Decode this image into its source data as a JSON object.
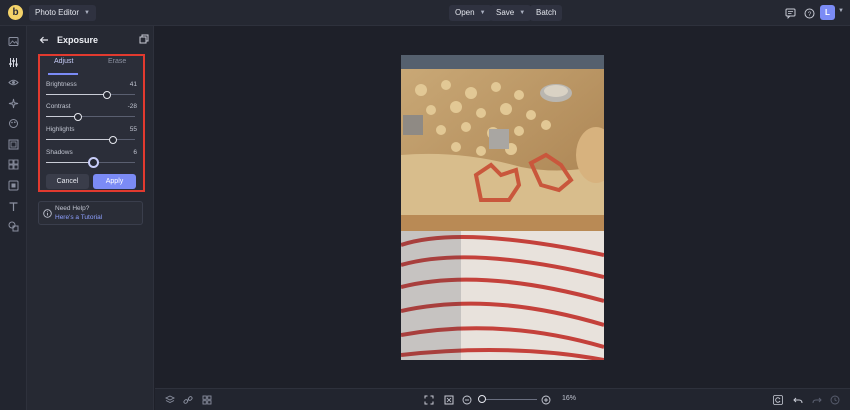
{
  "topbar": {
    "logo_letter": "b",
    "app_switch_label": "Photo Editor",
    "open_label": "Open",
    "save_label": "Save",
    "batch_label": "Batch",
    "avatar_letter": "L"
  },
  "panel": {
    "title": "Exposure",
    "tabs": [
      {
        "label": "Adjust",
        "active": true
      },
      {
        "label": "Erase",
        "active": false
      }
    ],
    "sliders": [
      {
        "label": "Brightness",
        "value": "41",
        "position": 0.69
      },
      {
        "label": "Contrast",
        "value": "-28",
        "position": 0.36
      },
      {
        "label": "Highlights",
        "value": "55",
        "position": 0.75
      },
      {
        "label": "Shadows",
        "value": "6",
        "position": 0.53
      }
    ],
    "cancel_label": "Cancel",
    "apply_label": "Apply",
    "help_line1": "Need Help?",
    "help_line2": "Here's a Tutorial"
  },
  "rail_icons": [
    "image-icon",
    "adjust-sliders-icon",
    "eye-icon",
    "effects-sparkle-icon",
    "paint-brush-icon",
    "frame-icon",
    "collage-grid-icon",
    "texture-icon",
    "text-icon",
    "graphics-icon"
  ],
  "bottombar": {
    "zoom_value": "16%",
    "zoom_position": 0.05
  },
  "colors": {
    "accent": "#7b8bf5",
    "highlight_border": "#e23a2f",
    "background": "#1e2029",
    "panel": "#262933"
  }
}
